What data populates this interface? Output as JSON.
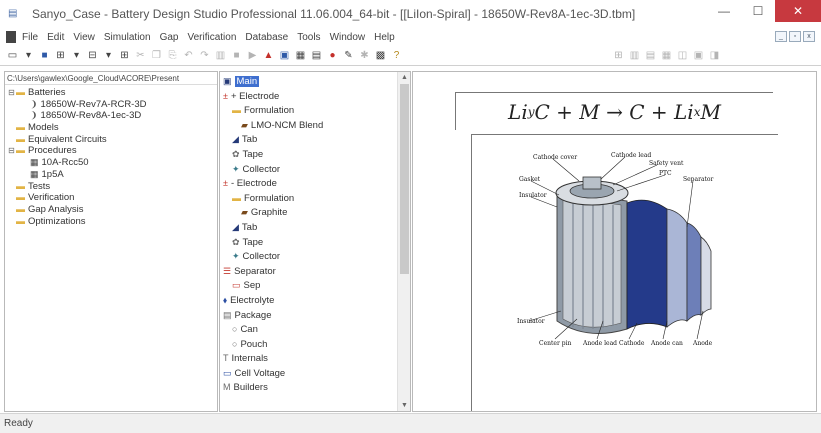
{
  "window": {
    "title": "Sanyo_Case - Battery Design Studio Professional 11.06.004_64-bit - [[LiIon-Spiral] - 18650W-Rev8A-1ec-3D.tbm]"
  },
  "menubar": {
    "items": [
      "File",
      "Edit",
      "View",
      "Simulation",
      "Gap",
      "Verification",
      "Database",
      "Tools",
      "Window",
      "Help"
    ]
  },
  "left_pane": {
    "path": "C:\\Users\\gawlex\\Google_Cloud\\ACORE\\Present",
    "tree": [
      {
        "label": "Batteries",
        "icon": "folder-icon",
        "toggle": "−",
        "level": 0
      },
      {
        "label": "18650W-Rev7A-RCR-3D",
        "icon": "cell-document-icon",
        "toggle": "",
        "level": 1
      },
      {
        "label": "18650W-Rev8A-1ec-3D",
        "icon": "cell-document-icon",
        "toggle": "",
        "level": 1
      },
      {
        "label": "Models",
        "icon": "folder-icon",
        "toggle": "",
        "level": 0
      },
      {
        "label": "Equivalent Circuits",
        "icon": "folder-icon",
        "toggle": "",
        "level": 0
      },
      {
        "label": "Procedures",
        "icon": "folder-icon",
        "toggle": "−",
        "level": 0
      },
      {
        "label": "10A-Rcc50",
        "icon": "procedure-icon",
        "toggle": "",
        "level": 1
      },
      {
        "label": "1p5A",
        "icon": "procedure-icon",
        "toggle": "",
        "level": 1
      },
      {
        "label": "Tests",
        "icon": "folder-icon",
        "toggle": "",
        "level": 0
      },
      {
        "label": "Verification",
        "icon": "folder-icon",
        "toggle": "",
        "level": 0
      },
      {
        "label": "Gap Analysis",
        "icon": "folder-icon",
        "toggle": "",
        "level": 0
      },
      {
        "label": "Optimizations",
        "icon": "folder-icon",
        "toggle": "",
        "level": 0
      }
    ]
  },
  "mid_pane": {
    "tree": [
      {
        "label": "Main",
        "icon": "main-icon",
        "level": 0,
        "selected": true
      },
      {
        "label": "+ Electrode",
        "icon": "electrode-icon",
        "level": 0
      },
      {
        "label": "Formulation",
        "icon": "folder-icon",
        "level": 1
      },
      {
        "label": "LMO-NCM Blend",
        "icon": "material-icon",
        "level": 2
      },
      {
        "label": "Tab",
        "icon": "tab-icon",
        "level": 1
      },
      {
        "label": "Tape",
        "icon": "tape-icon",
        "level": 1
      },
      {
        "label": "Collector",
        "icon": "collector-icon",
        "level": 1
      },
      {
        "label": "- Electrode",
        "icon": "electrode-icon",
        "level": 0
      },
      {
        "label": "Formulation",
        "icon": "folder-icon",
        "level": 1
      },
      {
        "label": "Graphite",
        "icon": "material-icon",
        "level": 2
      },
      {
        "label": "Tab",
        "icon": "tab-icon",
        "level": 1
      },
      {
        "label": "Tape",
        "icon": "tape-icon",
        "level": 1
      },
      {
        "label": "Collector",
        "icon": "collector-icon",
        "level": 1
      },
      {
        "label": "Separator",
        "icon": "separator-icon",
        "level": 0
      },
      {
        "label": "Sep",
        "icon": "sep-icon",
        "level": 1
      },
      {
        "label": "Electrolyte",
        "icon": "electrolyte-icon",
        "level": 0
      },
      {
        "label": "Package",
        "icon": "package-icon",
        "level": 0
      },
      {
        "label": "Can",
        "icon": "radio-icon",
        "level": 1
      },
      {
        "label": "Pouch",
        "icon": "radio-icon",
        "level": 1
      },
      {
        "label": "Internals",
        "icon": "internals-icon",
        "level": 0
      },
      {
        "label": "Cell Voltage",
        "icon": "voltage-icon",
        "level": 0
      },
      {
        "label": "Builders",
        "icon": "builders-icon",
        "level": 0
      }
    ]
  },
  "right_pane": {
    "equation": {
      "a": "Li",
      "a_sub": "y",
      "b": "C + M",
      "arrow": "→",
      "c": "C + Li",
      "c_sub": "x",
      "d": "M"
    },
    "cell_labels": {
      "top": [
        "Cathode cover",
        "Cathode lead",
        "Safety vent",
        "PTC",
        "Gasket",
        "Insulator",
        "Separator"
      ],
      "bottom": [
        "Insulator",
        "Center pin",
        "Anode lead",
        "Cathode",
        "Anode can",
        "Anode"
      ]
    }
  },
  "status": {
    "text": "Ready"
  }
}
